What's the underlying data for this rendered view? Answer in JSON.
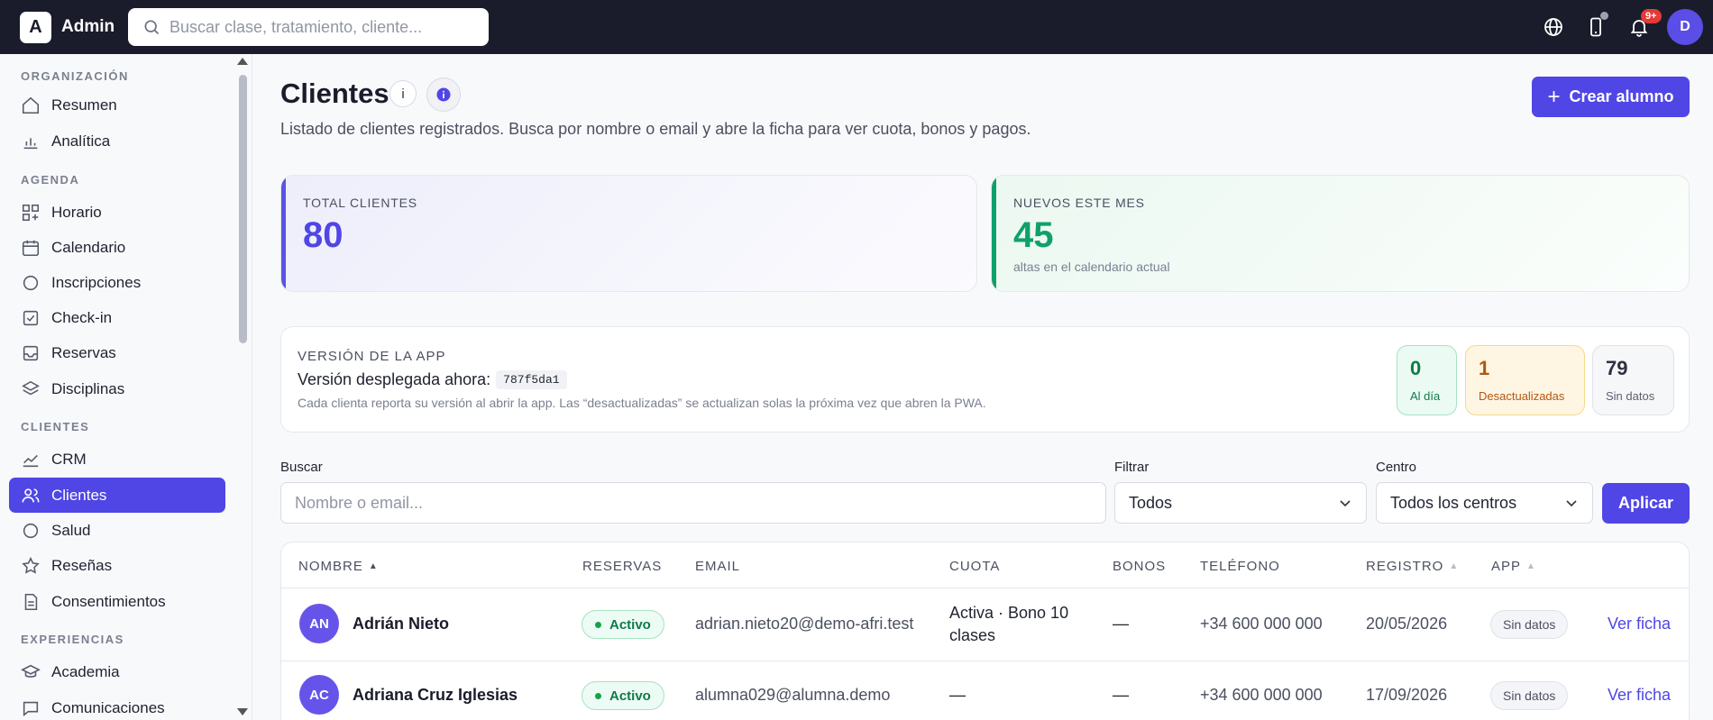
{
  "topbar": {
    "logo_letter": "A",
    "app_name": "Admin",
    "search_placeholder": "Buscar clase, tratamiento, cliente...",
    "notifications_badge": "9+",
    "user_initial": "D"
  },
  "sidebar": {
    "sections": [
      {
        "title": "ORGANIZACIÓN",
        "items": [
          {
            "label": "Resumen",
            "icon": "home-icon"
          },
          {
            "label": "Analítica",
            "icon": "bar-chart-icon"
          }
        ]
      },
      {
        "title": "AGENDA",
        "items": [
          {
            "label": "Horario",
            "icon": "grid-plus-icon"
          },
          {
            "label": "Calendario",
            "icon": "calendar-icon"
          },
          {
            "label": "Inscripciones",
            "icon": "circle-icon"
          },
          {
            "label": "Check-in",
            "icon": "check-square-icon"
          },
          {
            "label": "Reservas",
            "icon": "inbox-icon"
          },
          {
            "label": "Disciplinas",
            "icon": "layers-icon"
          }
        ]
      },
      {
        "title": "CLIENTES",
        "items": [
          {
            "label": "CRM",
            "icon": "trend-icon"
          },
          {
            "label": "Clientes",
            "icon": "users-icon",
            "active": true
          },
          {
            "label": "Salud",
            "icon": "circle-icon"
          },
          {
            "label": "Reseñas",
            "icon": "star-icon"
          },
          {
            "label": "Consentimientos",
            "icon": "document-icon"
          }
        ]
      },
      {
        "title": "EXPERIENCIAS",
        "items": [
          {
            "label": "Academia",
            "icon": "graduation-cap-icon"
          },
          {
            "label": "Comunicaciones",
            "icon": "chat-icon"
          }
        ]
      }
    ]
  },
  "header": {
    "title": "Clientes",
    "info_letter": "i",
    "subtitle": "Listado de clientes registrados. Busca por nombre o email y abre la ficha para ver cuota, bonos y pagos.",
    "create_label": "Crear alumno"
  },
  "stats": {
    "total": {
      "label": "TOTAL CLIENTES",
      "value": "80",
      "color": "#4f46e5"
    },
    "new": {
      "label": "NUEVOS ESTE MES",
      "value": "45",
      "note": "altas en el calendario actual",
      "color": "#10a06b"
    }
  },
  "app_version": {
    "label": "VERSIÓN DE LA APP",
    "line": "Versión desplegada ahora:",
    "code": "787f5da1",
    "note": "Cada clienta reporta su versión al abrir la app. Las “desactualizadas” se actualizan solas la próxima vez que abren la PWA.",
    "counts": [
      {
        "num": "0",
        "label": "Al día"
      },
      {
        "num": "1",
        "label": "Desactualizadas"
      },
      {
        "num": "79",
        "label": "Sin datos"
      }
    ]
  },
  "filters": {
    "search_label": "Buscar",
    "search_placeholder": "Nombre o email...",
    "filter_label": "Filtrar",
    "filter_value": "Todos",
    "center_label": "Centro",
    "center_value": "Todos los centros",
    "apply_label": "Aplicar"
  },
  "table": {
    "columns": [
      "NOMBRE",
      "RESERVAS",
      "EMAIL",
      "CUOTA",
      "BONOS",
      "TELÉFONO",
      "REGISTRO",
      "APP"
    ],
    "rows": [
      {
        "initials": "AN",
        "name": "Adrián Nieto",
        "reservas": "Activo",
        "email": "adrian.nieto20@demo-afri.test",
        "cuota_line1": "Activa · Bono 10",
        "cuota_line2": "clases",
        "bonos": "—",
        "telefono": "+34 600 000 000",
        "registro": "20/05/2026",
        "app": "Sin datos",
        "action": "Ver ficha"
      },
      {
        "initials": "AC",
        "name": "Adriana Cruz Iglesias",
        "reservas": "Activo",
        "email": "alumna029@alumna.demo",
        "cuota_line1": "—",
        "cuota_line2": "",
        "bonos": "—",
        "telefono": "+34 600 000 000",
        "registro": "17/09/2026",
        "app": "Sin datos",
        "action": "Ver ficha"
      }
    ]
  }
}
